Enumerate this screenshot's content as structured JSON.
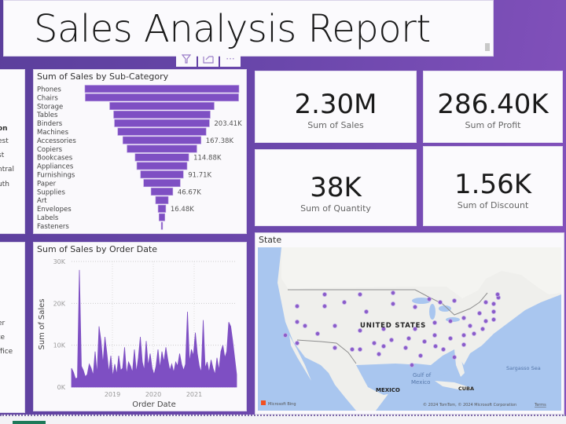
{
  "report": {
    "title": "Sales Analysis Report"
  },
  "visual_header": {
    "filter_icon": "filter-icon",
    "focus_icon": "focus-mode-icon",
    "more_icon": "more-options-icon",
    "more_label": "···",
    "filter_label": "⋎",
    "focus_label": "⧉"
  },
  "slicers": {
    "region": {
      "header_partial": "on",
      "items_partial": [
        "est",
        "st",
        "ntral",
        "uth"
      ]
    },
    "segment": {
      "items_partial": [
        "er",
        "te",
        "ffice"
      ]
    }
  },
  "kpis": [
    {
      "value": "2.30M",
      "label": "Sum of Sales"
    },
    {
      "value": "286.40K",
      "label": "Sum of Profit"
    },
    {
      "value": "38K",
      "label": "Sum of Quantity"
    },
    {
      "value": "1.56K",
      "label": "Sum of Discount"
    }
  ],
  "map": {
    "title": "State",
    "labels": {
      "country": "UNITED STATES",
      "mexico": "MEXICO",
      "gulf": "Gulf of Mexico",
      "cuba": "CUBA",
      "sea": "Sargasso Sea"
    },
    "attribution": "© 2024 TomTom, © 2024 Microsoft Corporation",
    "terms": "Terms",
    "brand": "Microsoft Bing",
    "dot_color": "#8a5cc9"
  },
  "colors": {
    "accent": "#7e4fc3",
    "background": "#6a47ab"
  },
  "chart_data": [
    {
      "type": "bar",
      "subtype": "funnel",
      "title": "Sum of Sales by Sub-Category",
      "categories": [
        "Phones",
        "Chairs",
        "Storage",
        "Tables",
        "Binders",
        "Machines",
        "Accessories",
        "Copiers",
        "Bookcases",
        "Appliances",
        "Furnishings",
        "Paper",
        "Supplies",
        "Art",
        "Envelopes",
        "Labels",
        "Fasteners"
      ],
      "values": [
        330007,
        328449,
        223844,
        206966,
        203413,
        189239,
        167380,
        149528,
        114880,
        107532,
        91705,
        78479,
        46674,
        27119,
        16476,
        12486,
        3024
      ],
      "data_labels": {
        "Binders": "203.41K",
        "Accessories": "167.38K",
        "Bookcases": "114.88K",
        "Furnishings": "91.71K",
        "Supplies": "46.67K",
        "Envelopes": "16.48K"
      },
      "color": "#7e4fc3"
    },
    {
      "type": "area",
      "title": "Sum of Sales by Order Date",
      "xlabel": "Order Date",
      "ylabel": "Sum of Sales",
      "x_ticks": [
        "2019",
        "2020",
        "2021"
      ],
      "y_ticks": [
        "0K",
        "10K",
        "20K",
        "30K"
      ],
      "ylim": [
        0,
        30000
      ],
      "xlim": [
        "2018-01",
        "2021-12"
      ],
      "grid": true,
      "color": "#7e4fc3",
      "series_sampled": [
        4500,
        3500,
        2000,
        2200,
        28000,
        5000,
        4000,
        2500,
        3000,
        5500,
        4500,
        2800,
        8500,
        3000,
        14500,
        11000,
        5500,
        12000,
        8000,
        3500,
        7500,
        2500,
        5500,
        3000,
        7500,
        4000,
        4500,
        9500,
        3000,
        6000,
        5000,
        3500,
        9000,
        3500,
        7000,
        12000,
        6000,
        4000,
        11000,
        5000,
        8000,
        4500,
        3000,
        5000,
        9000,
        4500,
        8500,
        6000,
        9500,
        6500,
        4000,
        5500,
        3500,
        6000,
        5000,
        8000,
        5500,
        4000,
        5500,
        18000,
        6000,
        9000,
        7500,
        13000,
        8000,
        5000,
        3500,
        16000,
        4500,
        6000,
        3500,
        6500,
        4500,
        3000,
        7000,
        4000,
        8500,
        10000,
        7000,
        8500,
        15500,
        14500,
        11000,
        7000,
        3000
      ]
    }
  ]
}
